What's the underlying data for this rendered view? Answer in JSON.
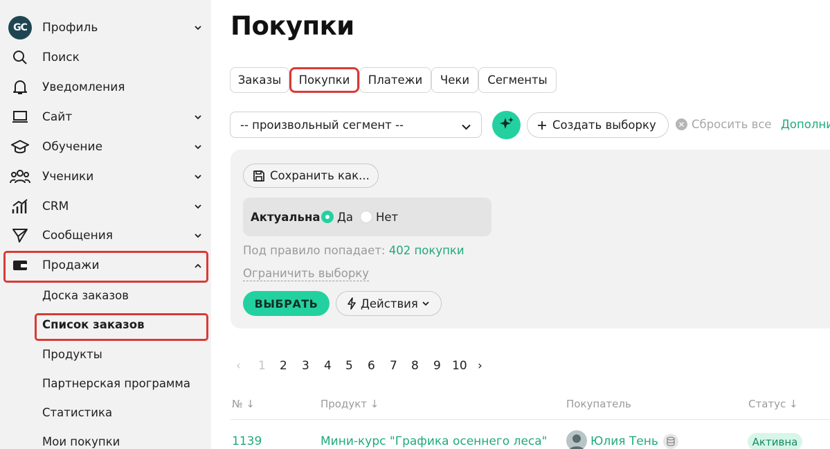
{
  "sidebar": {
    "logo_text": "GC",
    "items": [
      {
        "label": "Профиль",
        "icon": "avatar"
      },
      {
        "label": "Поиск",
        "icon": "search-icon"
      },
      {
        "label": "Уведомления",
        "icon": "bell-icon"
      },
      {
        "label": "Сайт",
        "icon": "laptop-icon"
      },
      {
        "label": "Обучение",
        "icon": "graduation-cap-icon"
      },
      {
        "label": "Ученики",
        "icon": "users-icon"
      },
      {
        "label": "CRM",
        "icon": "chart-icon"
      },
      {
        "label": "Сообщения",
        "icon": "send-icon"
      },
      {
        "label": "Продажи",
        "icon": "wallet-icon"
      }
    ],
    "sub_items": [
      "Доска заказов",
      "Список заказов",
      "Продукты",
      "Партнерская программа",
      "Статистика",
      "Мои покупки"
    ]
  },
  "page": {
    "title": "Покупки",
    "tabs": [
      "Заказы",
      "Покупки",
      "Платежи",
      "Чеки",
      "Сегменты"
    ],
    "active_tab": "Покупки"
  },
  "filters": {
    "segment_value": "-- произвольный сегмент --",
    "create_label": "Создать выборку",
    "reset_label": "Сбросить все",
    "more_label": "Дополни",
    "save_label": "Сохранить как...",
    "rule_label": "Актуальна",
    "yes_label": "Да",
    "no_label": "Нет",
    "selected": "Да",
    "matches_prefix": "Под правило попадает:",
    "matches_count": "402 покупки",
    "limit_label": "Ограничить выборку",
    "choose_label": "ВЫБРАТЬ",
    "actions_label": "Действия"
  },
  "pagination": {
    "prev": "‹",
    "pages": [
      "1",
      "2",
      "3",
      "4",
      "5",
      "6",
      "7",
      "8",
      "9",
      "10"
    ],
    "next": "›",
    "current": "1"
  },
  "table": {
    "columns": [
      "№ ↓",
      "Продукт ↓",
      "Покупатель",
      "Статус ↓"
    ],
    "rows": [
      {
        "id": "1139",
        "product": "Мини-курс \"Графика осеннего леса\"",
        "buyer": "Юлия Тень",
        "status": "Активна"
      }
    ]
  },
  "colors": {
    "accent": "#23d1a0",
    "link": "#1faa7a",
    "highlight": "#d93a36",
    "sidebar_bg": "#f2f2f2"
  }
}
